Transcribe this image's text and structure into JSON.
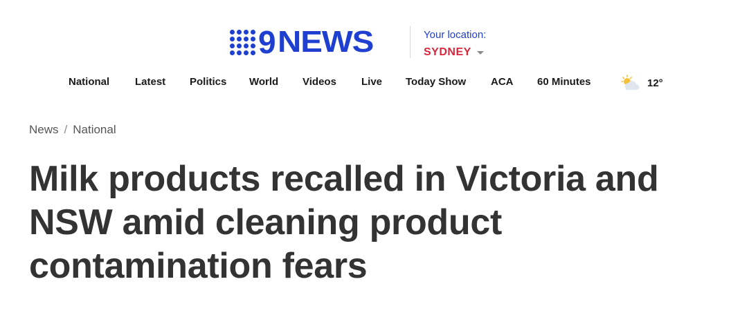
{
  "header": {
    "logo_text": "NEWS",
    "logo_nine": "9",
    "location_label": "Your location:",
    "location_city": "SYDNEY",
    "brand_color": "#1e3fd0",
    "city_color": "#d7263d"
  },
  "nav": {
    "items": [
      {
        "label": "National"
      },
      {
        "label": "Latest"
      },
      {
        "label": "Politics"
      },
      {
        "label": "World"
      },
      {
        "label": "Videos"
      },
      {
        "label": "Live"
      },
      {
        "label": "Today Show"
      },
      {
        "label": "ACA"
      },
      {
        "label": "60 Minutes"
      }
    ],
    "weather": {
      "icon": "partly-cloudy-icon",
      "temperature": "12°"
    }
  },
  "breadcrumb": {
    "items": [
      "News",
      "National"
    ],
    "separator": "/"
  },
  "article": {
    "headline": "Milk products recalled in Victoria and NSW amid cleaning product contamination fears"
  }
}
